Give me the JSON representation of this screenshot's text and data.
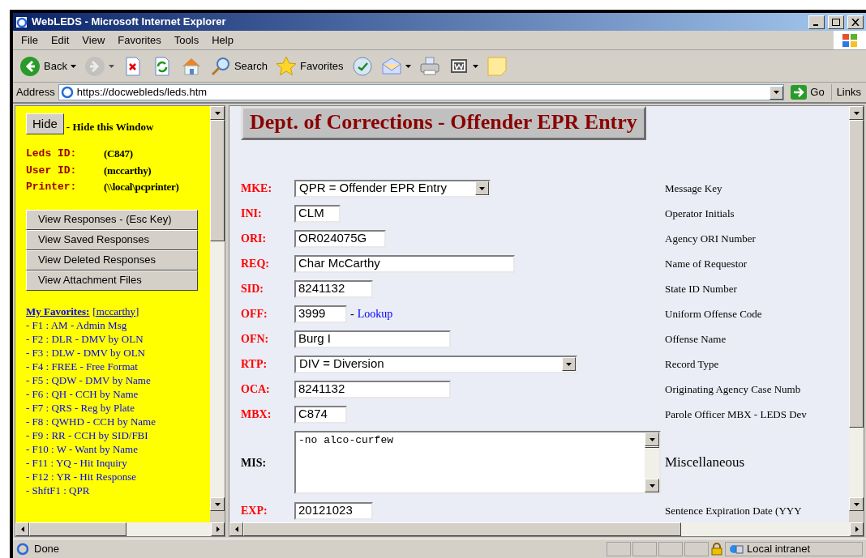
{
  "window": {
    "title": "WebLEDS - Microsoft Internet Explorer"
  },
  "menu": [
    "File",
    "Edit",
    "View",
    "Favorites",
    "Tools",
    "Help"
  ],
  "toolbar": [
    {
      "kind": "back",
      "label": "Back",
      "menu": true,
      "disabled": false
    },
    {
      "kind": "forward",
      "menu": true,
      "disabled": true
    },
    {
      "kind": "stop",
      "menu": false,
      "disabled": false
    },
    {
      "kind": "refresh",
      "menu": false,
      "disabled": false
    },
    {
      "kind": "home",
      "menu": false,
      "disabled": false
    },
    {
      "kind": "search",
      "label": "Search",
      "menu": false,
      "disabled": false
    },
    {
      "kind": "favorites",
      "label": "Favorites",
      "menu": false,
      "disabled": false
    },
    {
      "kind": "media",
      "menu": false,
      "disabled": false
    },
    {
      "kind": "mail",
      "menu": true,
      "disabled": false
    },
    {
      "kind": "print",
      "menu": false,
      "disabled": false
    },
    {
      "kind": "edit",
      "menu": true,
      "disabled": false
    },
    {
      "kind": "note",
      "menu": false,
      "disabled": false
    }
  ],
  "address": {
    "label": "Address",
    "url": "https://docwebleds/leds.htm",
    "go": "Go",
    "links": "Links"
  },
  "sidebar": {
    "hide_button": "Hide",
    "hide_text": "- Hide this Window",
    "info": [
      {
        "label": "Leds ID:",
        "value": "(C847)"
      },
      {
        "label": "User ID:",
        "value": "(mccarthy)"
      },
      {
        "label": "Printer:",
        "value": "(\\\\local\\pcprinter)"
      }
    ],
    "buttons": [
      "View Responses - (Esc Key)",
      "View Saved Responses",
      "View Deleted Responses",
      "View Attachment Files"
    ],
    "favorites_title": "My Favorites:",
    "favorites_user": "[mccarthy]",
    "favorites": [
      "- F1 : AM - Admin Msg",
      "- F2 : DLR - DMV by OLN",
      "- F3 : DLW - DMV by OLN",
      "- F4 : FREE - Free Format",
      "- F5 : QDW - DMV by Name",
      "- F6 : QH - CCH by Name",
      "- F7 : QRS - Reg by Plate",
      "- F8 : QWHD - CCH by Name",
      "- F9 : RR - CCH by SID/FBI",
      "- F10 : W - Want by Name",
      "- F11 : YQ - Hit Inquiry",
      "- F12 : YR - Hit Response",
      "- ShftF1 : QPR"
    ]
  },
  "form": {
    "title": "Dept. of Corrections - Offender EPR Entry",
    "fields": [
      {
        "label": "MKE:",
        "required": true,
        "kind": "select",
        "value": "QPR = Offender EPR Entry",
        "description": "Message Key"
      },
      {
        "label": "INI:",
        "required": true,
        "kind": "text",
        "value": "CLM",
        "description": "Operator Initials"
      },
      {
        "label": "ORI:",
        "required": true,
        "kind": "text",
        "value": "OR024075G",
        "description": "Agency ORI Number"
      },
      {
        "label": "REQ:",
        "required": true,
        "kind": "text",
        "value": "Char McCarthy",
        "description": "Name of Requestor"
      },
      {
        "label": "SID:",
        "required": true,
        "kind": "text",
        "value": "8241132",
        "description": "State ID Number"
      },
      {
        "label": "OFF:",
        "required": true,
        "kind": "text",
        "value": "3999",
        "link_prefix": "-",
        "link": "Lookup",
        "description": "Uniform Offense Code"
      },
      {
        "label": "OFN:",
        "required": true,
        "kind": "text",
        "value": "Burg I",
        "description": "Offense Name"
      },
      {
        "label": "RTP:",
        "required": true,
        "kind": "select",
        "value": "DIV = Diversion",
        "description": "Record Type"
      },
      {
        "label": "OCA:",
        "required": true,
        "kind": "text",
        "value": "8241132",
        "description": "Originating Agency Case Numb"
      },
      {
        "label": "MBX:",
        "required": true,
        "kind": "text",
        "value": "C874",
        "description": "Parole Officer MBX - LEDS Dev"
      },
      {
        "label": "MIS:",
        "required": false,
        "kind": "textarea",
        "value": "-no alco-curfew",
        "description": "Miscellaneous"
      },
      {
        "label": "EXP:",
        "required": true,
        "kind": "text",
        "value": "20121023",
        "description": "Sentence Expiration Date (YYY"
      }
    ]
  },
  "status": {
    "text": "Done",
    "zone": "Local intranet"
  }
}
